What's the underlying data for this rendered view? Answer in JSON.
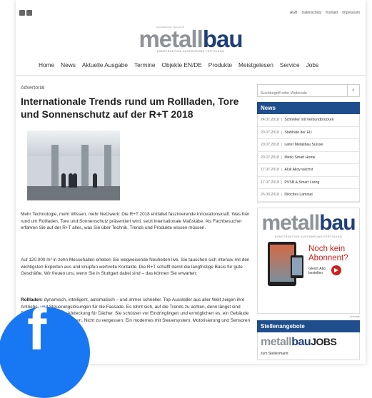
{
  "social": {
    "rss_icon": "rss-icon",
    "facebook_icon": "facebook-icon"
  },
  "top_links": [
    "AGB",
    "Datenschutz",
    "Kontakt",
    "Impressum"
  ],
  "logo": {
    "metal": "metall",
    "bau": "bau",
    "tagline_top": "SANIERUNG TECHNIK",
    "tagline_bottom": "KONSTRUKTION  AUSFÜHRUNG  FERTIGUNG"
  },
  "nav": [
    "Home",
    "News",
    "Aktuelle Ausgabe",
    "Termine",
    "Objekte EN/DE",
    "Produkte",
    "Meistgelesen",
    "Service",
    "Jobs"
  ],
  "article": {
    "category": "Advertorial",
    "title": "Internationale Trends rund um Rollladen, Tore und Sonnenschutz auf der R+T 2018",
    "p1": "Mehr Technologie, mehr Wissen, mehr Netzwerk: Die R+T 2018 entfaltet faszinierende Innovationskraft. Was hier rund um Rollladen, Tore und Sonnenschutz präsentiert wird, setzt internationale Maßstäbe. Als Fachbesucher erfahren Sie auf der R+T alles, was Sie über Technik, Trends und Produkte wissen müssen.",
    "p2": "Auf 120.000 m² in zehn Messehallen erleben Sie wegweisende Neuheiten live. Sie tauschen sich intensiv mit den wichtigsten Experten aus und knüpfen wertvolle Kontakte. Die R+T schafft damit die langfristige Basis für gute Geschäfte. Wir freuen uns, wenn Sie in Stuttgart dabei sind – das können Sie erwarten:",
    "p3_bold": "Rollladen:",
    "p3": " dynamisch, intelligent, automatisch – und immer schneller. Top-Aussteller aus aller Welt zeigen ihre Antriebs- und Steuerungslösungen für die Fassade. Es lohnt sich, auf die Trends zu achten, denn längst sind Rollladen mehr als nur Abdeckung für Dächer. Sie schützen vor Eindringlingen und ermöglichen es, ein Gebäude energieeffizienter zu gestalten. Nicht zu vergessen: Ein modernes mit Steuersystem, Motorisierung und Sensoren für"
  },
  "sidebar": {
    "search_placeholder": "Suchbegriff oder Webcode",
    "news_title": "News",
    "news": [
      {
        "date": "24.07.2018",
        "title": "Schneller mit Verbundbrücken"
      },
      {
        "date": "20.07.2018",
        "title": "Stahlräte der EU"
      },
      {
        "date": "20.07.2018",
        "title": "Leiter Metallbau Suisse"
      },
      {
        "date": "20.07.2018",
        "title": "Merkl Smart Home"
      },
      {
        "date": "17.07.2018",
        "title": "Aluk Alloy wächst"
      },
      {
        "date": "17.07.2018",
        "title": "PVSB & Smart Living"
      },
      {
        "date": "26.06.2018",
        "title": "Dilocites Laminat"
      }
    ],
    "ad": {
      "logo_metal": "metall",
      "logo_bau": "bau",
      "tagline": "KONSTRUKTION  AUSFÜHRUNG  FERTIGUNG",
      "line1": "Noch kein",
      "line2": "Abonnent?",
      "cta1": "Gleich Abo",
      "cta2": "bestellen",
      "anzeige": "Anzeige"
    },
    "jobs_title": "Stellenangebote",
    "jobs_logo_metal": "metall",
    "jobs_logo_bau": "bau",
    "jobs_logo_jobs": "JOBS",
    "jobs_link": "zum Stellenmarkt"
  },
  "colors": {
    "brand_blue": "#1f4e8c",
    "brand_grey": "#8e9398",
    "accent_red": "#d0201b",
    "facebook": "#1877f2"
  }
}
